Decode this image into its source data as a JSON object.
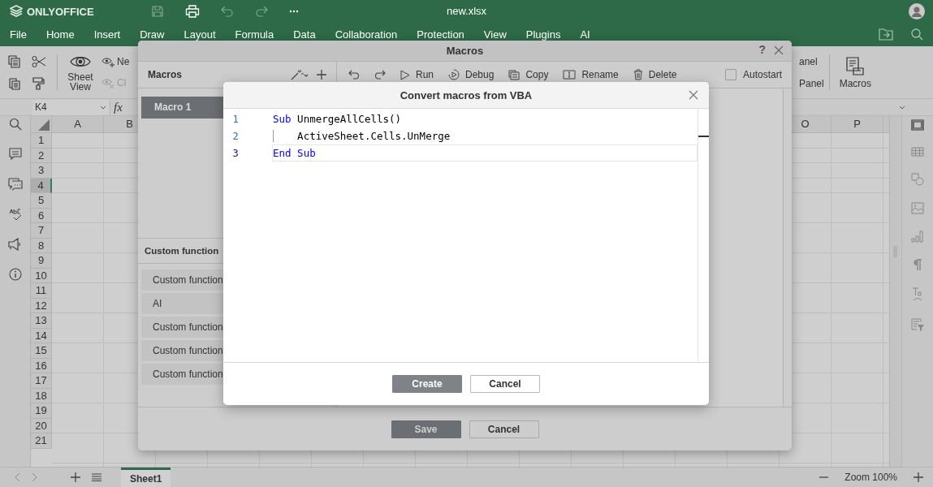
{
  "header": {
    "app_name": "ONLYOFFICE",
    "file_name": "new.xlsx"
  },
  "menu": [
    {
      "label": "File"
    },
    {
      "label": "Home"
    },
    {
      "label": "Insert"
    },
    {
      "label": "Draw"
    },
    {
      "label": "Layout"
    },
    {
      "label": "Formula"
    },
    {
      "label": "Data"
    },
    {
      "label": "Collaboration"
    },
    {
      "label": "Protection"
    },
    {
      "label": "View"
    },
    {
      "label": "Plugins"
    },
    {
      "label": "AI"
    }
  ],
  "toolbar": {
    "sheet_view": "Sheet View",
    "new_view": "Ne",
    "close_view": "Cl",
    "panel_top": "anel",
    "panel_bottom": "Panel",
    "macros": "Macros"
  },
  "formula_bar": {
    "cell_ref": "K4",
    "function_label": "fx"
  },
  "sheet": {
    "columns": [
      "A",
      "B",
      "O",
      "P"
    ],
    "rows": [
      {
        "label": "1",
        "selected": false
      },
      {
        "label": "2",
        "selected": false
      },
      {
        "label": "3",
        "selected": false
      },
      {
        "label": "4",
        "selected": true
      },
      {
        "label": "5",
        "selected": false
      },
      {
        "label": "6",
        "selected": false
      },
      {
        "label": "7",
        "selected": false
      },
      {
        "label": "8",
        "selected": false
      },
      {
        "label": "9",
        "selected": false
      },
      {
        "label": "10",
        "selected": false
      },
      {
        "label": "11",
        "selected": false
      },
      {
        "label": "12",
        "selected": false
      },
      {
        "label": "13",
        "selected": false
      },
      {
        "label": "14",
        "selected": false
      },
      {
        "label": "15",
        "selected": false
      },
      {
        "label": "16",
        "selected": false
      },
      {
        "label": "17",
        "selected": false
      },
      {
        "label": "18",
        "selected": false
      },
      {
        "label": "19",
        "selected": false
      },
      {
        "label": "20",
        "selected": false
      },
      {
        "label": "21",
        "selected": false
      }
    ]
  },
  "status_bar": {
    "sheets": [
      {
        "name": "Sheet1",
        "selected": true
      }
    ],
    "zoom": "Zoom 100%"
  },
  "macros_dialog": {
    "title": "Macros",
    "help": "?",
    "list_title": "Macros",
    "macros": [
      {
        "name": "Macro 1",
        "selected": true
      }
    ],
    "toolbar": [
      {
        "label": "Run",
        "kind": "run"
      },
      {
        "label": "Debug",
        "kind": "debug"
      },
      {
        "label": "Copy",
        "kind": "copy"
      },
      {
        "label": "Rename",
        "kind": "rename"
      },
      {
        "label": "Delete",
        "kind": "delete"
      }
    ],
    "autostart": {
      "label": "Autostart",
      "checked": false
    },
    "custom_functions_title": "Custom function",
    "custom_functions": [
      {
        "name": "Custom function",
        "selected": false
      },
      {
        "name": "AI",
        "selected": false
      },
      {
        "name": "Custom function",
        "selected": false
      },
      {
        "name": "Custom function",
        "selected": false
      },
      {
        "name": "Custom function",
        "selected": false
      }
    ],
    "buttons": [
      "Save",
      "Cancel"
    ]
  },
  "convert_dialog": {
    "title": "Convert macros from VBA",
    "lines": [
      {
        "number": "1",
        "current": false,
        "indent": false,
        "tokens": [
          {
            "text": "Sub",
            "kind": "keyword"
          },
          {
            "text": " UnmergeAllCells()",
            "kind": "plain"
          }
        ]
      },
      {
        "number": "2",
        "current": false,
        "indent": true,
        "tokens": [
          {
            "text": "    ActiveSheet.Cells.UnMerge",
            "kind": "plain"
          }
        ]
      },
      {
        "number": "3",
        "current": true,
        "indent": false,
        "tokens": [
          {
            "text": "End Sub",
            "kind": "keyword"
          }
        ]
      }
    ],
    "buttons": [
      "Create",
      "Cancel"
    ]
  }
}
